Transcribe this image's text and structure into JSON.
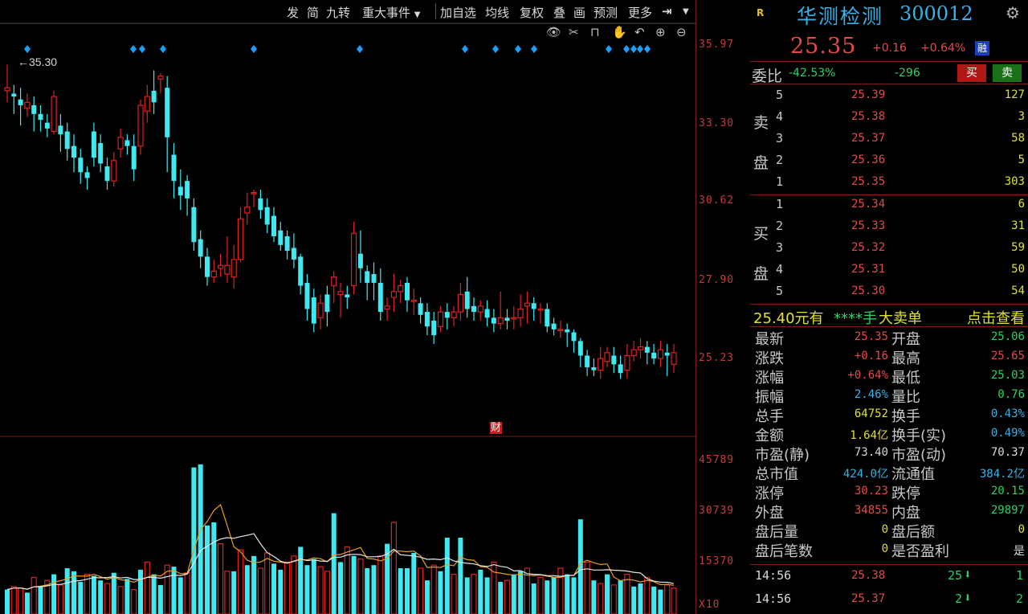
{
  "toolbar": {
    "items": [
      "发",
      "简",
      "九转",
      "重大事件",
      "加自选",
      "均线",
      "复权",
      "叠",
      "画",
      "预测",
      "更多"
    ],
    "dropdown_icon": "triangle-down-icon",
    "icons": [
      "eye-icon",
      "scissors-icon",
      "lock-icon",
      "hand-icon",
      "undo-icon",
      "zoom-in-icon",
      "zoom-out-icon"
    ]
  },
  "chart": {
    "price_axis_labels": [
      "35.97",
      "33.30",
      "30.62",
      "27.90",
      "25.23"
    ],
    "volume_axis_labels": [
      "45789",
      "30739",
      "15370",
      "X10"
    ],
    "marker_label": "35.30",
    "center_marker": "财",
    "colors": {
      "up": "#e02020",
      "down": "#40e8f0",
      "axis": "#c43c3c",
      "ma1": "#e8a020",
      "ma2": "#e8e8e8",
      "diamond": "#1aa0ff"
    },
    "candles": [
      [
        34.4,
        34.5,
        35.3,
        34.0
      ],
      [
        34.3,
        34.2,
        34.6,
        33.6
      ],
      [
        34.1,
        33.9,
        34.5,
        33.2
      ],
      [
        33.8,
        34.0,
        34.3,
        33.5
      ],
      [
        33.9,
        33.6,
        34.2,
        33.0
      ],
      [
        33.6,
        33.4,
        33.9,
        33.0
      ],
      [
        33.3,
        33.1,
        33.6,
        32.8
      ],
      [
        33.0,
        34.2,
        34.4,
        32.9
      ],
      [
        33.2,
        32.9,
        33.6,
        32.3
      ],
      [
        33.0,
        32.4,
        33.3,
        32.0
      ],
      [
        32.5,
        32.1,
        32.9,
        31.6
      ],
      [
        32.1,
        31.6,
        32.4,
        31.2
      ],
      [
        31.6,
        31.4,
        31.8,
        31.0
      ],
      [
        33.0,
        32.1,
        33.3,
        31.8
      ],
      [
        32.6,
        31.9,
        32.9,
        31.6
      ],
      [
        31.8,
        31.3,
        32.1,
        31.0
      ],
      [
        31.3,
        32.0,
        32.3,
        31.1
      ],
      [
        32.4,
        32.8,
        33.1,
        32.1
      ],
      [
        32.7,
        32.5,
        32.9,
        32.2
      ],
      [
        32.5,
        31.7,
        32.9,
        31.3
      ],
      [
        32.5,
        33.9,
        34.1,
        32.2
      ],
      [
        33.7,
        34.2,
        34.6,
        33.3
      ],
      [
        34.4,
        34.0,
        35.1,
        33.6
      ],
      [
        34.8,
        34.9,
        35.0,
        34.3
      ],
      [
        34.5,
        32.8,
        34.9,
        31.6
      ],
      [
        32.2,
        31.3,
        32.6,
        30.7
      ],
      [
        31.1,
        30.8,
        31.7,
        30.3
      ],
      [
        31.3,
        30.7,
        31.5,
        30.1
      ],
      [
        30.4,
        29.2,
        30.7,
        28.9
      ],
      [
        29.3,
        28.7,
        29.6,
        28.3
      ],
      [
        28.7,
        28.0,
        29.0,
        27.7
      ],
      [
        28.0,
        28.2,
        28.6,
        27.8
      ],
      [
        28.3,
        28.4,
        28.8,
        28.0
      ],
      [
        28.1,
        28.4,
        29.4,
        27.8
      ],
      [
        28.0,
        28.6,
        29.1,
        27.6
      ],
      [
        28.6,
        30.0,
        30.4,
        28.5
      ],
      [
        30.2,
        30.4,
        30.9,
        29.8
      ],
      [
        30.9,
        30.9,
        31.0,
        30.4
      ],
      [
        30.7,
        30.3,
        31.0,
        30.0
      ],
      [
        30.4,
        29.8,
        30.7,
        29.5
      ],
      [
        30.1,
        29.4,
        30.4,
        29.2
      ],
      [
        29.6,
        29.1,
        29.9,
        28.9
      ],
      [
        29.4,
        28.9,
        29.6,
        28.6
      ],
      [
        29.0,
        28.6,
        29.5,
        28.3
      ],
      [
        28.7,
        27.7,
        28.8,
        27.4
      ],
      [
        27.8,
        26.9,
        28.1,
        26.5
      ],
      [
        27.3,
        26.4,
        27.6,
        26.1
      ],
      [
        26.6,
        27.1,
        27.4,
        26.2
      ],
      [
        27.4,
        26.8,
        27.7,
        26.3
      ],
      [
        27.7,
        28.0,
        28.2,
        27.1
      ],
      [
        27.4,
        27.5,
        27.8,
        26.6
      ],
      [
        27.4,
        27.3,
        27.7,
        26.9
      ],
      [
        27.7,
        29.5,
        29.9,
        27.4
      ],
      [
        28.8,
        28.3,
        29.6,
        27.8
      ],
      [
        28.2,
        27.8,
        28.4,
        27.2
      ],
      [
        28.1,
        27.8,
        28.5,
        27.2
      ],
      [
        27.8,
        26.8,
        28.3,
        26.5
      ],
      [
        26.9,
        27.0,
        27.3,
        26.5
      ],
      [
        27.3,
        27.5,
        28.1,
        26.8
      ],
      [
        27.5,
        27.7,
        27.9,
        27.1
      ],
      [
        27.8,
        27.2,
        28.0,
        26.8
      ],
      [
        27.2,
        27.2,
        27.6,
        26.7
      ],
      [
        27.1,
        26.7,
        27.3,
        26.4
      ],
      [
        26.8,
        26.3,
        27.1,
        26.0
      ],
      [
        26.5,
        26.0,
        26.8,
        25.7
      ],
      [
        26.3,
        26.8,
        27.0,
        26.1
      ],
      [
        26.8,
        26.6,
        27.1,
        26.2
      ],
      [
        26.6,
        26.8,
        27.0,
        26.3
      ],
      [
        26.8,
        27.4,
        27.8,
        26.5
      ],
      [
        27.5,
        26.9,
        28.0,
        26.6
      ],
      [
        27.0,
        26.8,
        27.3,
        26.5
      ],
      [
        26.8,
        27.0,
        27.2,
        26.5
      ],
      [
        26.9,
        26.6,
        27.2,
        26.3
      ],
      [
        26.6,
        26.4,
        26.9,
        26.1
      ],
      [
        26.4,
        26.6,
        27.5,
        26.2
      ],
      [
        26.6,
        26.5,
        26.9,
        26.2
      ],
      [
        26.6,
        26.6,
        27.0,
        26.2
      ],
      [
        26.6,
        26.9,
        27.4,
        26.3
      ],
      [
        27.0,
        27.1,
        27.5,
        26.4
      ],
      [
        27.1,
        26.9,
        27.3,
        26.5
      ],
      [
        26.9,
        26.9,
        27.1,
        26.4
      ],
      [
        26.9,
        26.3,
        27.1,
        26.1
      ],
      [
        26.4,
        26.2,
        26.6,
        26.0
      ],
      [
        26.2,
        26.2,
        26.5,
        25.9
      ],
      [
        26.2,
        26.1,
        26.4,
        25.6
      ],
      [
        26.1,
        25.8,
        26.2,
        25.4
      ],
      [
        25.8,
        25.3,
        25.9,
        24.9
      ],
      [
        25.3,
        24.9,
        25.5,
        24.6
      ],
      [
        24.9,
        24.8,
        25.2,
        24.6
      ],
      [
        24.8,
        25.2,
        25.6,
        24.5
      ],
      [
        25.1,
        25.4,
        25.6,
        24.9
      ],
      [
        25.3,
        25.0,
        25.6,
        24.7
      ],
      [
        25.0,
        24.7,
        25.3,
        24.5
      ],
      [
        24.8,
        25.3,
        25.7,
        24.5
      ],
      [
        25.3,
        25.5,
        25.8,
        25.1
      ],
      [
        25.5,
        25.6,
        25.9,
        25.2
      ],
      [
        25.6,
        25.4,
        25.8,
        25.0
      ],
      [
        25.4,
        25.2,
        25.7,
        25.0
      ],
      [
        25.2,
        25.5,
        25.8,
        24.9
      ],
      [
        25.4,
        25.3,
        25.7,
        24.6
      ],
      [
        25.0,
        25.4,
        25.7,
        24.7
      ]
    ],
    "volumes": [
      [
        false,
        8000
      ],
      [
        true,
        9000
      ],
      [
        true,
        8500
      ],
      [
        false,
        7000
      ],
      [
        true,
        12000
      ],
      [
        false,
        9000
      ],
      [
        true,
        11000
      ],
      [
        false,
        13000
      ],
      [
        true,
        9500
      ],
      [
        false,
        15000
      ],
      [
        false,
        14000
      ],
      [
        false,
        10500
      ],
      [
        true,
        13000
      ],
      [
        false,
        12500
      ],
      [
        false,
        11000
      ],
      [
        true,
        10000
      ],
      [
        false,
        13500
      ],
      [
        true,
        9000
      ],
      [
        false,
        11500
      ],
      [
        true,
        8000
      ],
      [
        false,
        14500
      ],
      [
        true,
        17000
      ],
      [
        false,
        13000
      ],
      [
        false,
        9500
      ],
      [
        true,
        16000
      ],
      [
        false,
        15500
      ],
      [
        false,
        12000
      ],
      [
        true,
        13500
      ],
      [
        false,
        48000
      ],
      [
        false,
        49000
      ],
      [
        false,
        29000
      ],
      [
        false,
        30000
      ],
      [
        true,
        23000
      ],
      [
        true,
        14000
      ],
      [
        false,
        14000
      ],
      [
        true,
        21000
      ],
      [
        false,
        16000
      ],
      [
        false,
        19000
      ],
      [
        true,
        15000
      ],
      [
        true,
        20000
      ],
      [
        false,
        16500
      ],
      [
        false,
        14500
      ],
      [
        true,
        17000
      ],
      [
        true,
        19000
      ],
      [
        false,
        22000
      ],
      [
        false,
        16000
      ],
      [
        false,
        18000
      ],
      [
        true,
        15500
      ],
      [
        true,
        14000
      ],
      [
        false,
        33000
      ],
      [
        false,
        17000
      ],
      [
        true,
        22000
      ],
      [
        false,
        19000
      ],
      [
        true,
        18000
      ],
      [
        false,
        15000
      ],
      [
        false,
        16000
      ],
      [
        true,
        19000
      ],
      [
        false,
        23000
      ],
      [
        true,
        30000
      ],
      [
        false,
        15000
      ],
      [
        false,
        15000
      ],
      [
        false,
        20000
      ],
      [
        true,
        15000
      ],
      [
        false,
        11000
      ],
      [
        true,
        16000
      ],
      [
        false,
        14000
      ],
      [
        false,
        25000
      ],
      [
        true,
        13000
      ],
      [
        false,
        25000
      ],
      [
        false,
        12000
      ],
      [
        true,
        13000
      ],
      [
        false,
        14500
      ],
      [
        false,
        12000
      ],
      [
        true,
        17000
      ],
      [
        false,
        10500
      ],
      [
        true,
        11000
      ],
      [
        false,
        13000
      ],
      [
        false,
        14000
      ],
      [
        true,
        15000
      ],
      [
        false,
        10000
      ],
      [
        true,
        12000
      ],
      [
        false,
        11000
      ],
      [
        false,
        12000
      ],
      [
        true,
        15000
      ],
      [
        false,
        13000
      ],
      [
        false,
        12000
      ],
      [
        false,
        31000
      ],
      [
        true,
        17000
      ],
      [
        false,
        11000
      ],
      [
        true,
        10000
      ],
      [
        false,
        13000
      ],
      [
        true,
        9500
      ],
      [
        false,
        11000
      ],
      [
        true,
        13000
      ],
      [
        false,
        9000
      ],
      [
        false,
        10000
      ],
      [
        true,
        12000
      ],
      [
        false,
        9000
      ],
      [
        false,
        8000
      ],
      [
        true,
        9500
      ],
      [
        true,
        8500
      ]
    ],
    "diamonds_x": [
      34,
      166,
      177,
      203,
      316,
      448,
      579,
      617,
      645,
      665,
      758,
      780,
      789,
      797,
      806
    ]
  },
  "panel": {
    "logo": "R",
    "name": "华测检测",
    "code": "300012",
    "gear_icon": "gear-icon",
    "price": "25.35",
    "change": "+0.16",
    "pct": "+0.64%",
    "rong": "融",
    "weibi_label": "委比",
    "weibi_pct": "-42.53%",
    "weibi_diff": "-296",
    "buy_btn": "买",
    "sell_btn": "卖",
    "sell_side": [
      "卖",
      "盘"
    ],
    "buy_side": [
      "买",
      "盘"
    ],
    "asks": [
      {
        "lvl": "5",
        "price": "25.39",
        "vol": "127"
      },
      {
        "lvl": "4",
        "price": "25.38",
        "vol": "3"
      },
      {
        "lvl": "3",
        "price": "25.37",
        "vol": "58"
      },
      {
        "lvl": "2",
        "price": "25.36",
        "vol": "5"
      },
      {
        "lvl": "1",
        "price": "25.35",
        "vol": "303"
      }
    ],
    "bids": [
      {
        "lvl": "1",
        "price": "25.34",
        "vol": "6"
      },
      {
        "lvl": "2",
        "price": "25.33",
        "vol": "31"
      },
      {
        "lvl": "3",
        "price": "25.32",
        "vol": "59"
      },
      {
        "lvl": "4",
        "price": "25.31",
        "vol": "50"
      },
      {
        "lvl": "5",
        "price": "25.30",
        "vol": "54"
      }
    ],
    "big_order": {
      "price": "25.40元有",
      "hands": "****手",
      "label": "大卖单",
      "link": "点击查看"
    },
    "quotes": [
      {
        "l1": "最新",
        "v1": "25.35",
        "c1": "#e54a4a",
        "l2": "开盘",
        "v2": "25.06",
        "c2": "#30d060"
      },
      {
        "l1": "涨跌",
        "v1": "+0.16",
        "c1": "#e54a4a",
        "l2": "最高",
        "v2": "25.65",
        "c2": "#e54a4a"
      },
      {
        "l1": "涨幅",
        "v1": "+0.64%",
        "c1": "#e54a4a",
        "l2": "最低",
        "v2": "25.03",
        "c2": "#30d060"
      },
      {
        "l1": "振幅",
        "v1": "2.46%",
        "c1": "#38b0e8",
        "l2": "量比",
        "v2": "0.76",
        "c2": "#30d060"
      },
      {
        "l1": "总手",
        "v1": "64752",
        "c1": "#e0e030",
        "l2": "换手",
        "v2": "0.43%",
        "c2": "#38b0e8"
      },
      {
        "l1": "金额",
        "v1": "1.64亿",
        "c1": "#e0e030",
        "l2": "换手(实)",
        "v2": "0.49%",
        "c2": "#38b0e8"
      },
      {
        "l1": "市盈(静)",
        "v1": "73.40",
        "c1": "#d8d8d8",
        "l2": "市盈(动)",
        "v2": "70.37",
        "c2": "#d8d8d8"
      },
      {
        "l1": "总市值",
        "v1": "424.0亿",
        "c1": "#38b0e8",
        "l2": "流通值",
        "v2": "384.2亿",
        "c2": "#38b0e8"
      },
      {
        "l1": "涨停",
        "v1": "30.23",
        "c1": "#e54a4a",
        "l2": "跌停",
        "v2": "20.15",
        "c2": "#30d060"
      },
      {
        "l1": "外盘",
        "v1": "34855",
        "c1": "#e54a4a",
        "l2": "内盘",
        "v2": "29897",
        "c2": "#30d060"
      },
      {
        "l1": "盘后量",
        "v1": "0",
        "c1": "#e0e030",
        "l2": "盘后额",
        "v2": "0",
        "c2": "#e0e030"
      },
      {
        "l1": "盘后笔数",
        "v1": "0",
        "c1": "#e0e030",
        "l2": "是否盈利",
        "v2": "是",
        "c2": "#d8d8d8"
      }
    ],
    "ticks": [
      {
        "time": "14:56",
        "price": "25.38",
        "vol": "25",
        "arrow": "arrow-down-icon",
        "n": "1"
      },
      {
        "time": "14:56",
        "price": "25.37",
        "vol": "2",
        "arrow": "arrow-down-icon",
        "n": "2"
      }
    ]
  }
}
